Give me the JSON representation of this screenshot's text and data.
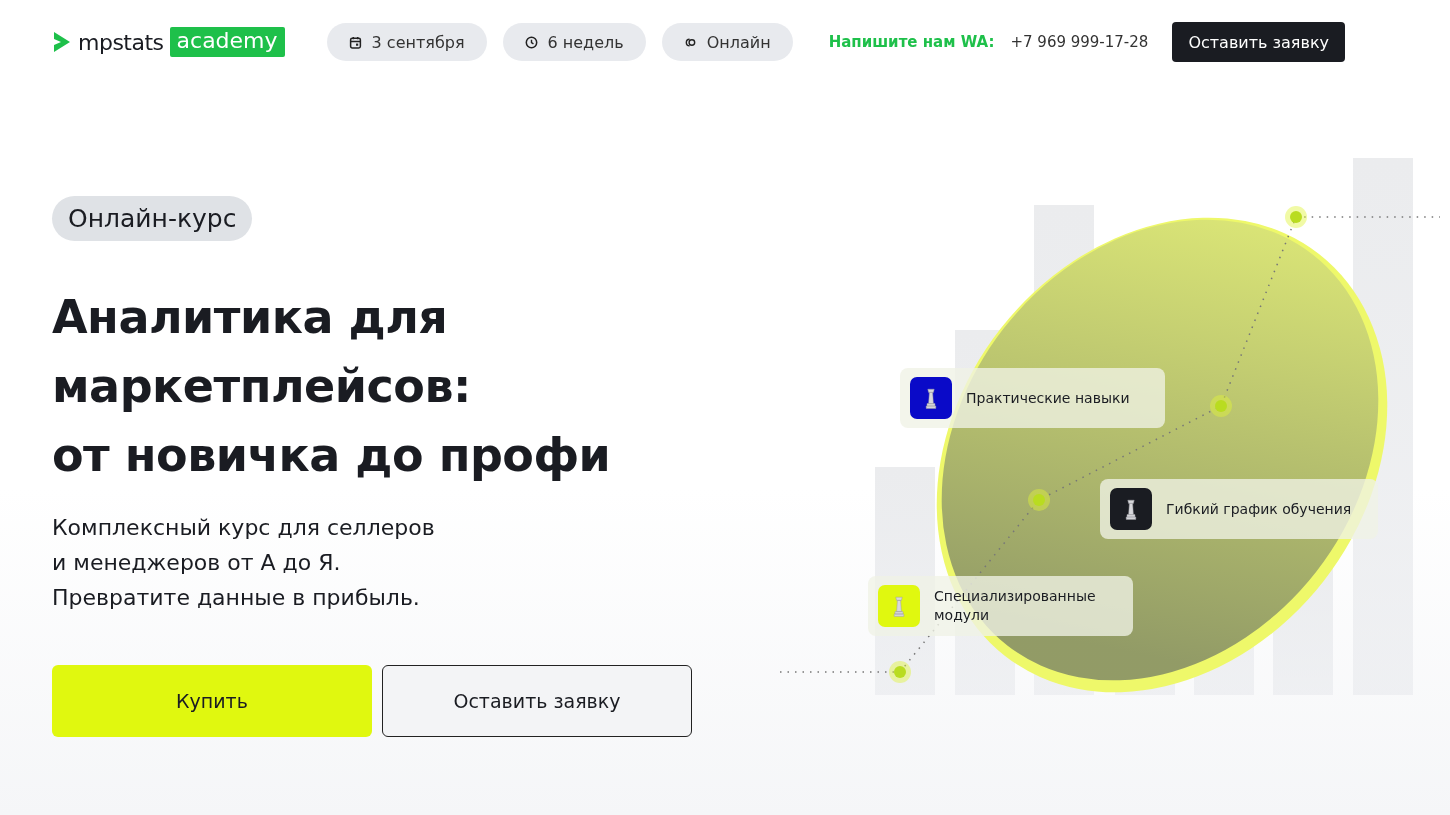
{
  "header": {
    "logo": {
      "name": "mpstats",
      "badge": "academy"
    },
    "pills": [
      {
        "kind": "calendar",
        "label": "3 сентября"
      },
      {
        "kind": "clock",
        "label": "6 недель"
      },
      {
        "kind": "online",
        "label": "Онлайн"
      }
    ],
    "contact_label": "Напишите нам WA:",
    "phone": "+7 969 999-17-28",
    "cta": "Оставить заявку"
  },
  "hero": {
    "tag": "Онлайн-курс",
    "title_lines": [
      "Аналитика для",
      "маркетплейсов:",
      "от новичка до профи"
    ],
    "subtitle_lines": [
      "Комплексный курс для селлеров",
      "и менеджеров от А до Я.",
      "Превратите данные в прибыль."
    ],
    "buttons": [
      {
        "kind": "primary",
        "label": "Купить"
      },
      {
        "kind": "secondary",
        "label": "Оставить заявку"
      }
    ]
  },
  "features": [
    {
      "label": "Практические навыки",
      "color": "#0a0ac8"
    },
    {
      "label": "Гибкий график обучения",
      "color": "#1a1c22"
    },
    {
      "label": "Специализированные модули",
      "color": "#e0f80f"
    }
  ]
}
